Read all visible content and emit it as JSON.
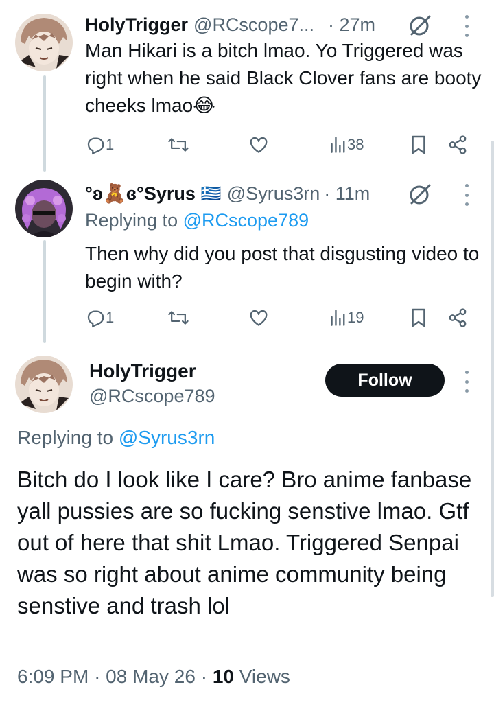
{
  "replies": [
    {
      "display_name": "HolyTrigger",
      "handle": "@RCscope7...",
      "time": "· 27m",
      "text": "Man Hikari is a bitch lmao. Yo Triggered was right when he said Black Clover fans are booty cheeks lmao😂",
      "reply_count": "1",
      "views": "38"
    },
    {
      "display_name": "°ʚ🧸ɞ°Syrus",
      "flag": "🇬🇷",
      "handle": "@Syrus3rn",
      "time": "· 11m",
      "replying_prefix": "Replying to",
      "replying_to": "@RCscope789",
      "text": "Then why did you post that disgusting video to begin with?",
      "reply_count": "1",
      "views": "19"
    }
  ],
  "main_tweet": {
    "display_name": "HolyTrigger",
    "handle": "@RCscope789",
    "follow_label": "Follow",
    "replying_prefix": "Replying to",
    "replying_to": "@Syrus3rn",
    "text": "Bitch do I look like I care? Bro anime fanbase yall pussies are so fucking senstive lmao. Gtf out of here that shit Lmao. Triggered Senpai was so right about anime community being senstive and trash lol",
    "time": "6:09 PM",
    "date": "08 May 26",
    "views_count": "10",
    "views_label": "Views"
  },
  "icons": [
    "reply-icon",
    "retweet-icon",
    "like-icon",
    "views-icon",
    "bookmark-icon",
    "share-icon",
    "grok-icon",
    "more-icon"
  ],
  "colors": {
    "text_primary": "#0f1419",
    "text_secondary": "#536471",
    "accent": "#1d9bf0",
    "thread_line": "#cfd9de",
    "follow_bg": "#0f1419"
  }
}
